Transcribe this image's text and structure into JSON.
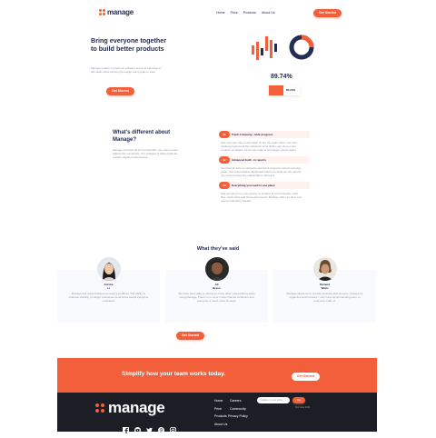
{
  "header": {
    "logo": "manage",
    "nav": [
      "Home",
      "Price",
      "Products",
      "About Us"
    ],
    "cta_label": "Get Started"
  },
  "hero": {
    "title": "Bring everyone together to build better products",
    "subtitle": "Manage makes it simple for software teams to plan day-to-day tasks while keeping the larger team goals in view.",
    "cta_label": "Get Started",
    "stat_percent": "89.74%",
    "stat_bar_value": "85.20%",
    "stat_bar_fraction": 0.852
  },
  "different": {
    "title": "What's different about Manage?",
    "text": "Manage provides all the functionality your team needs, without the complexity. Our software is tailor-made for modern digital product teams.",
    "features": [
      {
        "num": "01",
        "title": "Track Company - wide progress",
        "desc": "See how your day-to-day tasks fit into the wider vision. Go from tracking progress at the milestone level all the way done to the smallest of details. Never lose sight of the bigger picture again."
      },
      {
        "num": "02",
        "title": "Advanced built - in reports",
        "desc": "Set internal delivery estimates and track progress toward company goals. Our customisable dashboard helps you build out the reports you need to keep key stakeholders informed."
      },
      {
        "num": "03",
        "title": "Everything you need in one place",
        "desc": "Stop jumping from one service to another to communicate, store files, track tasks and share documents. Manage offers an all-in-one team productivity solution."
      }
    ]
  },
  "testimonials": {
    "title": "What they've said",
    "items": [
      {
        "name": "Anisha",
        "last": "Li",
        "quote": "Manage has supercharged our team's workflow. The ability to maintain visibility on larger milestones at all times keeps everyone motivated."
      },
      {
        "name": "Ali",
        "last": "Bravo",
        "quote": "We have been able to cancel so many other subscriptions since using Manage. There is no more cross-channel confusion and everyone is much more focused."
      },
      {
        "name": "Richard",
        "last": "Watts",
        "quote": "Manage allows us to provide structure and process. It keeps us organized and focused. I can't stop recommending them to everyone I talk to!"
      }
    ],
    "cta_label": "Get Started"
  },
  "cta_banner": {
    "text": "Simplify how your team works today.",
    "button_label": "Get Started"
  },
  "footer": {
    "logo": "manage",
    "links": [
      "Home",
      "Careers",
      "Price",
      "Community",
      "Products",
      "Privacy Policy",
      "About Us"
    ],
    "input_placeholder": "Updates in your inbox...",
    "go_label": "Go",
    "copyright": "Myrnette 2021"
  },
  "colors": {
    "accent": "#f25f3a",
    "navy": "#242d52",
    "footer_bg": "#1d1e25"
  }
}
